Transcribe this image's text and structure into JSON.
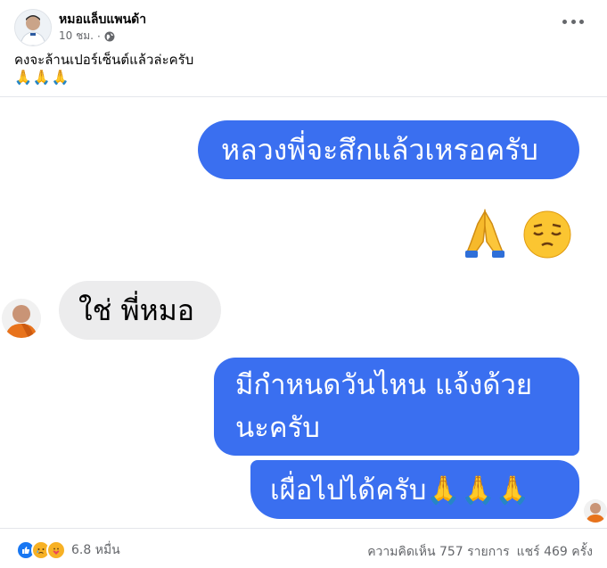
{
  "post": {
    "author": "หมอแล็บแพนด้า",
    "time": "10 ชม.",
    "separator": "·",
    "caption": "คงจะล้านเปอร์เซ็นต์แล้วล่ะครับ",
    "caption_emoji": "🙏🙏🙏"
  },
  "chat": {
    "message_1": "หลวงพี่จะสึกแล้วเหรอครับ",
    "emoji_1": "🙏",
    "emoji_2": "😔",
    "reply_1": "ใช่ พี่หมอ",
    "message_2_line1": "มีกำหนดวันไหน แจ้งด้วย",
    "message_2_line2": "นะครับ",
    "message_3": "เผื่อไปได้ครับ🙏🙏🙏"
  },
  "footer": {
    "reaction_count": "6.8 หมื่น",
    "comments": "ความคิดเห็น 757 รายการ",
    "shares": "แชร์ 469 ครั้ง"
  },
  "colors": {
    "bubble_blue": "#3a6ff0",
    "bubble_grey": "#ececed",
    "like_blue": "#1877f2",
    "secondary_text": "#65676b"
  },
  "icons": [
    "globe-icon",
    "more-icon",
    "like-icon",
    "sad-icon",
    "care-icon"
  ]
}
